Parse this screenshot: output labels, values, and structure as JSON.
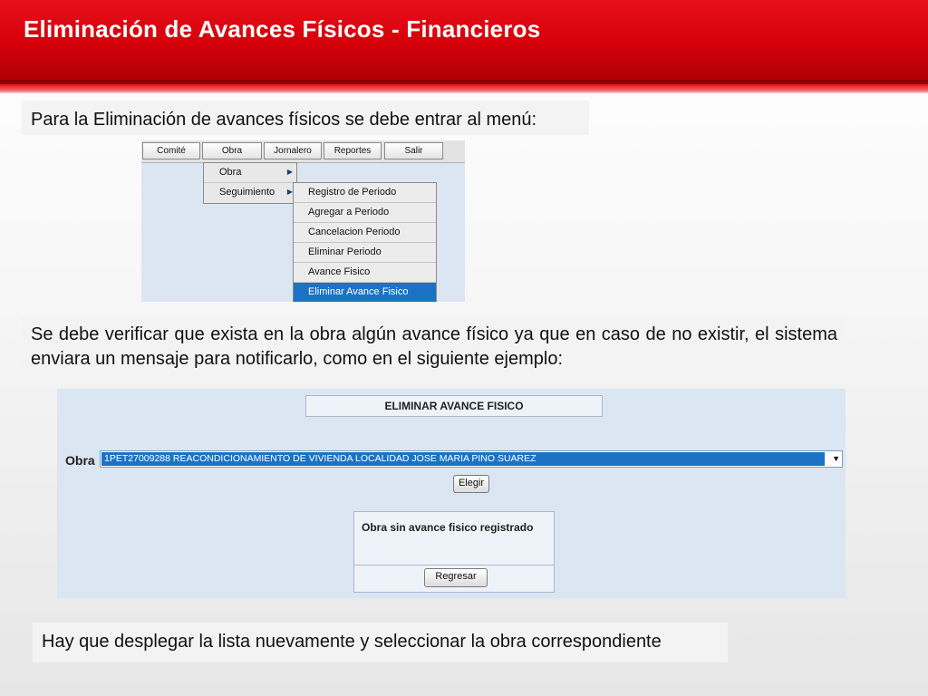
{
  "header": {
    "title": "Eliminación de Avances Físicos - Financieros"
  },
  "notes": {
    "menu_instruction": "Para la Eliminación de avances físicos se debe entrar al menú:",
    "verify_instruction": "Se debe verificar que exista en la obra algún avance físico ya que en caso de no existir, el sistema enviara un mensaje para notificarlo, como en el siguiente ejemplo:",
    "reselect_instruction": "Hay que desplegar la lista nuevamente y seleccionar la obra correspondiente"
  },
  "menu": {
    "bar_items": [
      "Comité",
      "Obra",
      "Jornalero",
      "Reportes",
      "Salir"
    ],
    "obra_submenu": [
      "Obra",
      "Seguimiento"
    ],
    "seguimiento_submenu": [
      "Registro de Periodo",
      "Agregar a Periodo",
      "Cancelacion Periodo",
      "Eliminar Periodo",
      "Avance Fisico",
      "Eliminar Avance Fisico"
    ],
    "selected_item": "Eliminar Avance Fisico",
    "highlight_color": "#1c73c6"
  },
  "form": {
    "title": "ELIMINAR AVANCE FISICO",
    "obra_label": "Obra",
    "obra_selected": "1PET27009288 REACONDICIONAMIENTO DE VIVIENDA LOCALIDAD JOSE MARIA PINO SUAREZ",
    "elegir_label": "Elegir",
    "message": "Obra sin avance fisico registrado",
    "regresar_label": "Regresar"
  },
  "colors": {
    "header_red": "#d4000a",
    "panel_blue": "#dbe6f3"
  }
}
